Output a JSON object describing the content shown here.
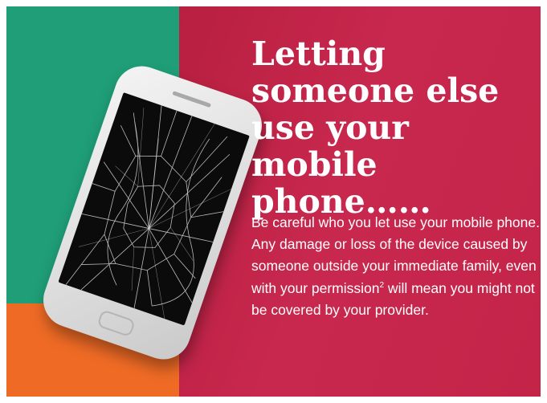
{
  "article": {
    "title": "Letting someone else use your mobile phone……",
    "body_before_sup": "Be careful who you let use your mobile phone. Any damage or loss of the device caused by someone outside your immediate family, even with your permission",
    "footnote_marker": "2",
    "body_after_sup": " will mean you might not be covered by your provider."
  },
  "image": {
    "subject": "cracked-smartphone"
  },
  "colors": {
    "background_red": "#c42448",
    "background_green": "#1f9e77",
    "background_orange": "#ef6b25",
    "text": "#ffffff"
  }
}
